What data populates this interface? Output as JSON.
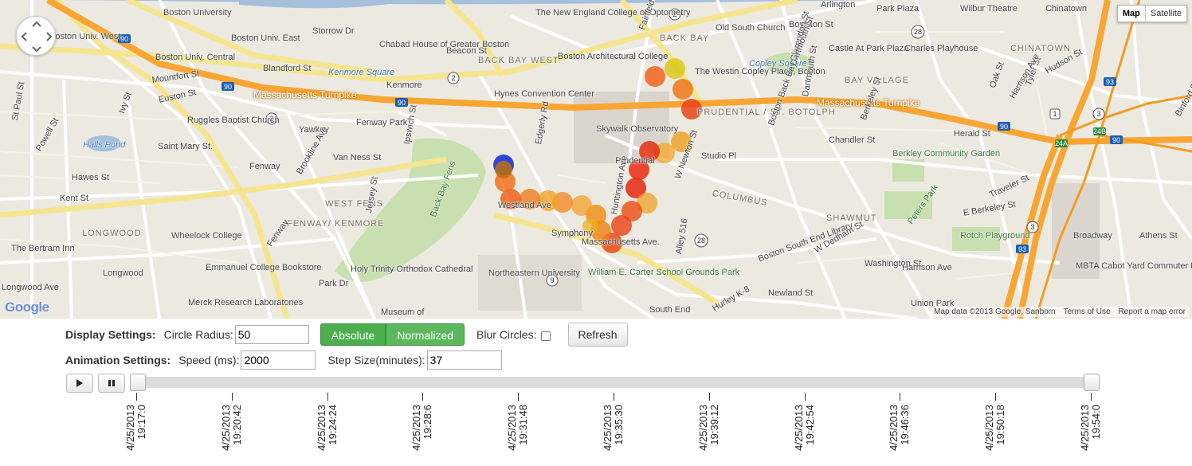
{
  "map": {
    "type_buttons": {
      "map": "Map",
      "satellite": "Satellite"
    },
    "attribution": {
      "data": "Map data ©2013 Google, Sanborn",
      "terms": "Terms of Use",
      "report": "Report a map error"
    },
    "logo": "Google",
    "labels": [
      {
        "t": "Storrow Dr",
        "c": "lbl"
      },
      {
        "t": "Boston University",
        "c": "lbl"
      },
      {
        "t": "Boston Univ. West",
        "c": "lbl"
      },
      {
        "t": "Boston Univ. Central",
        "c": "lbl"
      },
      {
        "t": "Boston Univ. East",
        "c": "lbl"
      },
      {
        "t": "Blandford St",
        "c": "lbl"
      },
      {
        "t": "Kenmore Square",
        "c": "lbl water"
      },
      {
        "t": "Kenmore",
        "c": "lbl"
      },
      {
        "t": "Chabad House of Greater Boston",
        "c": "lbl"
      },
      {
        "t": "Beacon St",
        "c": "lbl"
      },
      {
        "t": "BACK BAY WEST",
        "c": "lbl dist"
      },
      {
        "t": "Boston Architectural College",
        "c": "lbl"
      },
      {
        "t": "The New England College of Optometry",
        "c": "lbl"
      },
      {
        "t": "BACK BAY",
        "c": "lbl dist"
      },
      {
        "t": "Old South Church",
        "c": "lbl"
      },
      {
        "t": "Arlington",
        "c": "lbl"
      },
      {
        "t": "Boylston St",
        "c": "lbl"
      },
      {
        "t": "Park Plaza",
        "c": "lbl"
      },
      {
        "t": "Wilbur Theatre",
        "c": "lbl"
      },
      {
        "t": "Chinatown",
        "c": "lbl"
      },
      {
        "t": "CHINATOWN",
        "c": "lbl dist"
      },
      {
        "t": "Castle At Park Plaza",
        "c": "lbl"
      },
      {
        "t": "Charles Playhouse",
        "c": "lbl"
      },
      {
        "t": "Copley Square",
        "c": "lbl water"
      },
      {
        "t": "BAY VILLAGE",
        "c": "lbl dist"
      },
      {
        "t": "Massachusetts Turnpike",
        "c": "lbl hwy"
      },
      {
        "t": "Massachusetts Turnpike",
        "c": "lbl hwy"
      },
      {
        "t": "Mountfort St",
        "c": "lbl"
      },
      {
        "t": "Euston St",
        "c": "lbl"
      },
      {
        "t": "Ruggles Baptist Church",
        "c": "lbl"
      },
      {
        "t": "Hynes Convention Center",
        "c": "lbl"
      },
      {
        "t": "Yawkey",
        "c": "lbl"
      },
      {
        "t": "Fenway Park",
        "c": "lbl"
      },
      {
        "t": "Saint Mary St.",
        "c": "lbl"
      },
      {
        "t": "Halls Pond",
        "c": "lbl water"
      },
      {
        "t": "Fenway",
        "c": "lbl"
      },
      {
        "t": "Hawes St",
        "c": "lbl"
      },
      {
        "t": "Kent St",
        "c": "lbl"
      },
      {
        "t": "Van Ness St",
        "c": "lbl"
      },
      {
        "t": "Brookline Ave",
        "c": "lbl"
      },
      {
        "t": "WEST FENS",
        "c": "lbl dist"
      },
      {
        "t": "FENWAY/ KENMORE",
        "c": "lbl dist"
      },
      {
        "t": "LONGWOOD",
        "c": "lbl dist"
      },
      {
        "t": "Wheelock College",
        "c": "lbl"
      },
      {
        "t": "Longwood",
        "c": "lbl"
      },
      {
        "t": "The Bertram Inn",
        "c": "lbl"
      },
      {
        "t": "Longwood Ave",
        "c": "lbl"
      },
      {
        "t": "Emmanuel College Bookstore",
        "c": "lbl"
      },
      {
        "t": "Merck Research Laboratories",
        "c": "lbl"
      },
      {
        "t": "Fenway",
        "c": "lbl"
      },
      {
        "t": "Park Dr",
        "c": "lbl"
      },
      {
        "t": "Back Bay Fens",
        "c": "lbl park"
      },
      {
        "t": "Holy Trinity Orthodox Cathedral",
        "c": "lbl"
      },
      {
        "t": "Westland Ave",
        "c": "lbl"
      },
      {
        "t": "Symphony",
        "c": "lbl"
      },
      {
        "t": "Massachusetts Ave.",
        "c": "lbl"
      },
      {
        "t": "Northeastern University",
        "c": "lbl"
      },
      {
        "t": "William E. Carter School Grounds Park",
        "c": "lbl park"
      },
      {
        "t": "Museum of",
        "c": "lbl"
      },
      {
        "t": "Skywalk Observatory",
        "c": "lbl"
      },
      {
        "t": "Prudential",
        "c": "lbl"
      },
      {
        "t": "PRUDENTIAL / ST. BOTOLPH",
        "c": "lbl dist"
      },
      {
        "t": "The Westin Copley Place, Boston",
        "c": "lbl"
      },
      {
        "t": "Boston Back Bay",
        "c": "lbl"
      },
      {
        "t": "Clarendon St",
        "c": "lbl"
      },
      {
        "t": "Dartmouth St",
        "c": "lbl"
      },
      {
        "t": "Berkeley St",
        "c": "lbl"
      },
      {
        "t": "Chandler St",
        "c": "lbl"
      },
      {
        "t": "Berkley Community Garden",
        "c": "lbl park"
      },
      {
        "t": "Herald St",
        "c": "lbl"
      },
      {
        "t": "COLUMBUS",
        "c": "lbl dist"
      },
      {
        "t": "W Newton St",
        "c": "lbl"
      },
      {
        "t": "Studio Pl",
        "c": "lbl"
      },
      {
        "t": "SHAWMUT",
        "c": "lbl dist"
      },
      {
        "t": "Peters Park",
        "c": "lbl park"
      },
      {
        "t": "E Berkeley St",
        "c": "lbl"
      },
      {
        "t": "Traveler St",
        "c": "lbl"
      },
      {
        "t": "Rotch Playground",
        "c": "lbl park"
      },
      {
        "t": "Broadway",
        "c": "lbl"
      },
      {
        "t": "MBTA Cabot Yard Commuter Rail Train Maintenance Facility",
        "c": "lbl"
      },
      {
        "t": "Washington St",
        "c": "lbl"
      },
      {
        "t": "Harrison Ave",
        "c": "lbl"
      },
      {
        "t": "Boston South End Library",
        "c": "lbl"
      },
      {
        "t": "W Dedham St",
        "c": "lbl"
      },
      {
        "t": "South End",
        "c": "lbl"
      },
      {
        "t": "Hurley K-8",
        "c": "lbl"
      },
      {
        "t": "Union Park",
        "c": "lbl"
      },
      {
        "t": "Newland St",
        "c": "lbl"
      },
      {
        "t": "Hudson St",
        "c": "lbl"
      },
      {
        "t": "Oak St",
        "c": "lbl"
      },
      {
        "t": "Tyler St",
        "c": "lbl"
      },
      {
        "t": "Harrison Ave",
        "c": "lbl"
      },
      {
        "t": "Binford St",
        "c": "lbl"
      },
      {
        "t": "Athens St",
        "c": "lbl"
      },
      {
        "t": "Ivy St",
        "c": "lbl"
      },
      {
        "t": "Powell St",
        "c": "lbl"
      },
      {
        "t": "St Paul St",
        "c": "lbl"
      },
      {
        "t": "Edgerly Rd",
        "c": "lbl"
      },
      {
        "t": "Ipswich St",
        "c": "lbl"
      },
      {
        "t": "Jersey St",
        "c": "lbl"
      },
      {
        "t": "Fairfield St",
        "c": "lbl"
      },
      {
        "t": "Dartmouth St",
        "c": "lbl"
      },
      {
        "t": "Alley 516",
        "c": "lbl"
      },
      {
        "t": "Huntington Ave",
        "c": "lbl"
      }
    ]
  },
  "controls": {
    "display_label": "Display Settings:",
    "radius_label": "Circle Radius:",
    "radius_value": "50",
    "absolute": "Absolute",
    "normalized": "Normalized",
    "blur_label": "Blur Circles:",
    "refresh": "Refresh",
    "animation_label": "Animation Settings:",
    "speed_label": "Speed (ms):",
    "speed_value": "2000",
    "step_label": "Step Size(minutes):",
    "step_value": "37",
    "play_icon": "play-icon",
    "pause_icon": "pause-icon",
    "ticks": [
      {
        "date": "4/25/2013",
        "time": "19:17:0"
      },
      {
        "date": "4/25/2013",
        "time": "19:20:42"
      },
      {
        "date": "4/25/2013",
        "time": "19:24:24"
      },
      {
        "date": "4/25/2013",
        "time": "19:28:6"
      },
      {
        "date": "4/25/2013",
        "time": "19:31:48"
      },
      {
        "date": "4/25/2013",
        "time": "19:35:30"
      },
      {
        "date": "4/25/2013",
        "time": "19:39:12"
      },
      {
        "date": "4/25/2013",
        "time": "19:42:54"
      },
      {
        "date": "4/25/2013",
        "time": "19:46:36"
      },
      {
        "date": "4/25/2013",
        "time": "19:50:18"
      },
      {
        "date": "4/25/2013",
        "time": "19:54:0"
      }
    ]
  }
}
